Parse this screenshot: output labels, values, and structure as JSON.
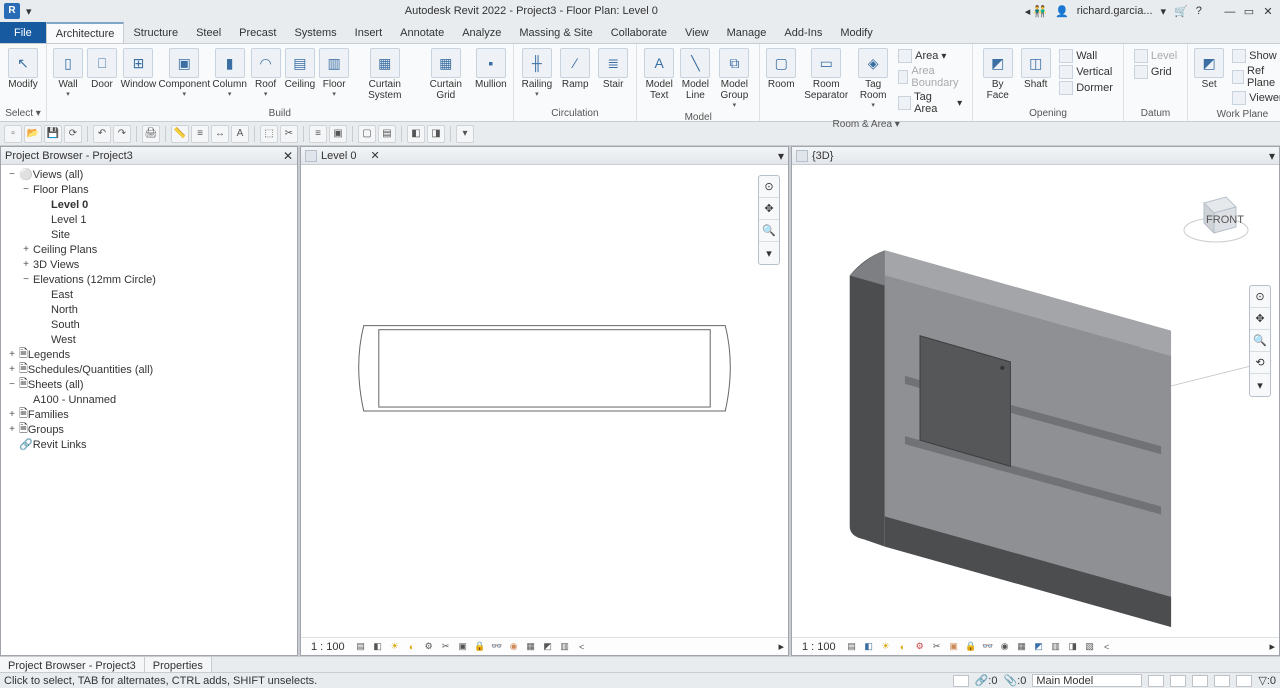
{
  "titlebar": {
    "app_abbrev": "R",
    "title": "Autodesk Revit 2022 - Project3 - Floor Plan: Level 0",
    "user": "richard.garcia...",
    "search_hint": "▸",
    "help_icon": "?"
  },
  "menus": {
    "file": "File",
    "tabs": [
      "Architecture",
      "Structure",
      "Steel",
      "Precast",
      "Systems",
      "Insert",
      "Annotate",
      "Analyze",
      "Massing & Site",
      "Collaborate",
      "View",
      "Manage",
      "Add-Ins",
      "Modify"
    ],
    "active": "Architecture"
  },
  "ribbon": {
    "select": {
      "label": "Modify",
      "group": "Select ▾"
    },
    "build": {
      "label": "Build",
      "buttons": [
        "Wall",
        "Door",
        "Window",
        "Component",
        "Column",
        "Roof",
        "Ceiling",
        "Floor",
        "Curtain System",
        "Curtain Grid",
        "Mullion"
      ]
    },
    "circulation": {
      "label": "Circulation",
      "buttons": [
        "Railing",
        "Ramp",
        "Stair"
      ]
    },
    "model": {
      "label": "Model",
      "buttons": [
        "Model Text",
        "Model Line",
        "Model Group"
      ]
    },
    "roomarea": {
      "label": "Room & Area ▾",
      "big": [
        "Room",
        "Room Separator",
        "Tag Room"
      ],
      "small": [
        "Area",
        "Area Boundary",
        "Tag Area"
      ]
    },
    "opening": {
      "label": "Opening",
      "buttons": [
        "By Face",
        "Shaft",
        "Wall",
        "Vertical",
        "Dormer"
      ]
    },
    "datum": {
      "label": "Datum",
      "buttons": [
        "Level",
        "Grid"
      ]
    },
    "workplane": {
      "label": "Work Plane",
      "big": "Set",
      "small": [
        "Show",
        "Ref Plane",
        "Viewer"
      ]
    }
  },
  "project_browser": {
    "title": "Project Browser - Project3",
    "views_all": "Views (all)",
    "floor_plans": "Floor Plans",
    "level0": "Level 0",
    "level1": "Level 1",
    "site": "Site",
    "ceiling": "Ceiling Plans",
    "3d": "3D Views",
    "elev": "Elevations (12mm Circle)",
    "east": "East",
    "north": "North",
    "south": "South",
    "west": "West",
    "legends": "Legends",
    "schedules": "Schedules/Quantities (all)",
    "sheets": "Sheets (all)",
    "a100": "A100 - Unnamed",
    "families": "Families",
    "groups": "Groups",
    "revit_links": "Revit Links"
  },
  "viewports": {
    "level0": {
      "title": "Level 0",
      "scale": "1 : 100"
    },
    "v3d": {
      "title": "{3D}",
      "scale": "1 : 100",
      "cube_front": "FRONT"
    }
  },
  "bottom": {
    "tab1": "Project Browser - Project3",
    "tab2": "Properties"
  },
  "status": {
    "hint": "Click to select, TAB for alternates, CTRL adds, SHIFT unselects.",
    "zero_a": ":0",
    "zero_b": ":0",
    "main_model": "Main Model",
    "filter_zero": ":0"
  }
}
